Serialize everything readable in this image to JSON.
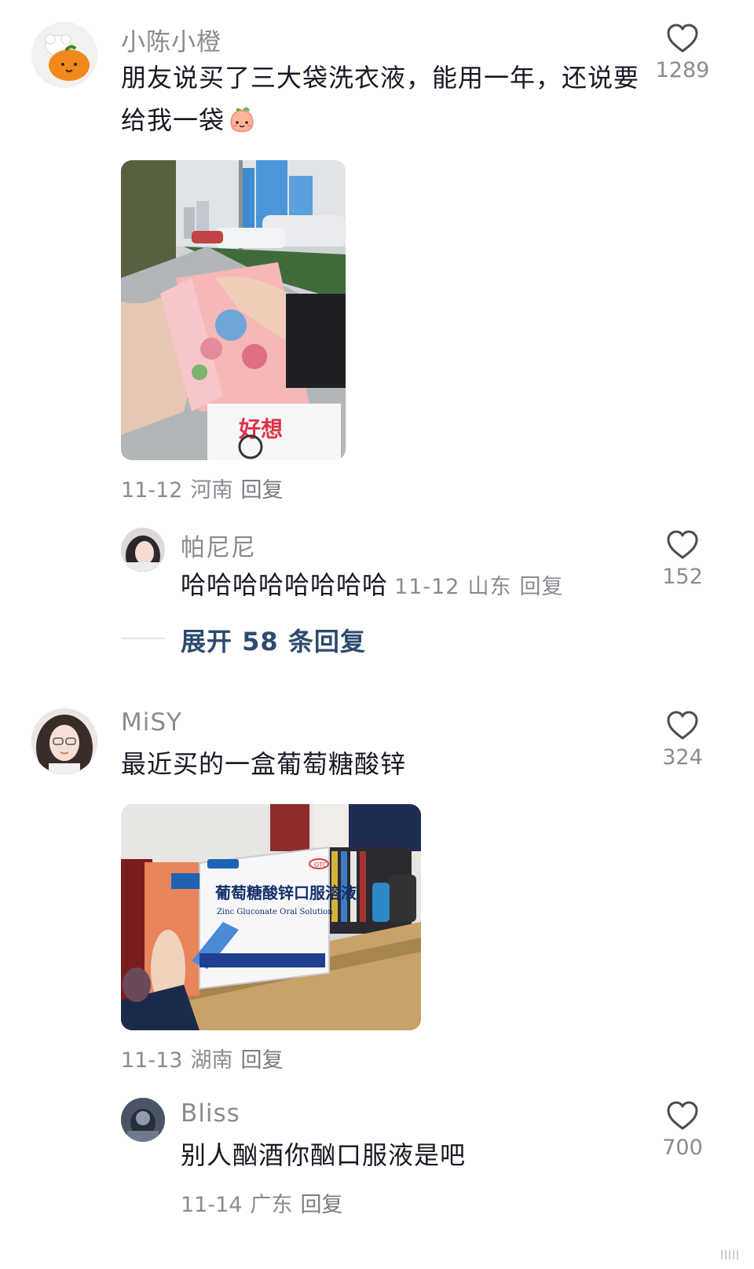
{
  "comments": [
    {
      "username": "小陈小橙",
      "text": "朋友说买了三大袋洗衣液，能用一年，还说要给我一袋",
      "emoji": "peach-emoji",
      "likes": "1289",
      "date": "11-12",
      "location": "河南",
      "reply_label": "回复",
      "sub_reply": {
        "username": "帕尼尼",
        "text": "哈哈哈哈哈哈哈哈",
        "date": "11-12",
        "location": "山东",
        "reply_label": "回复",
        "likes": "152"
      },
      "expand_label": "展开 58 条回复"
    },
    {
      "username": "MiSY",
      "text": "最近买的一盒葡萄糖酸锌",
      "likes": "324",
      "date": "11-13",
      "location": "湖南",
      "reply_label": "回复",
      "photo_text": {
        "box_title": "葡萄糖酸锌口服溶液",
        "box_subtitle": "Zinc Gluconate Oral Solution",
        "otc": "OTC"
      },
      "sub_reply": {
        "username": "Bliss",
        "text": "别人酗酒你酗口服液是吧",
        "date": "11-14",
        "location": "广东",
        "reply_label": "回复",
        "likes": "700"
      }
    }
  ],
  "colors": {
    "text": "#161823",
    "muted": "#8a8b91",
    "link": "#2e4a6e",
    "divider": "#e4e4e6"
  },
  "icons": [
    "heart-icon",
    "peach-emoji",
    "scroll-indicator-icon"
  ]
}
